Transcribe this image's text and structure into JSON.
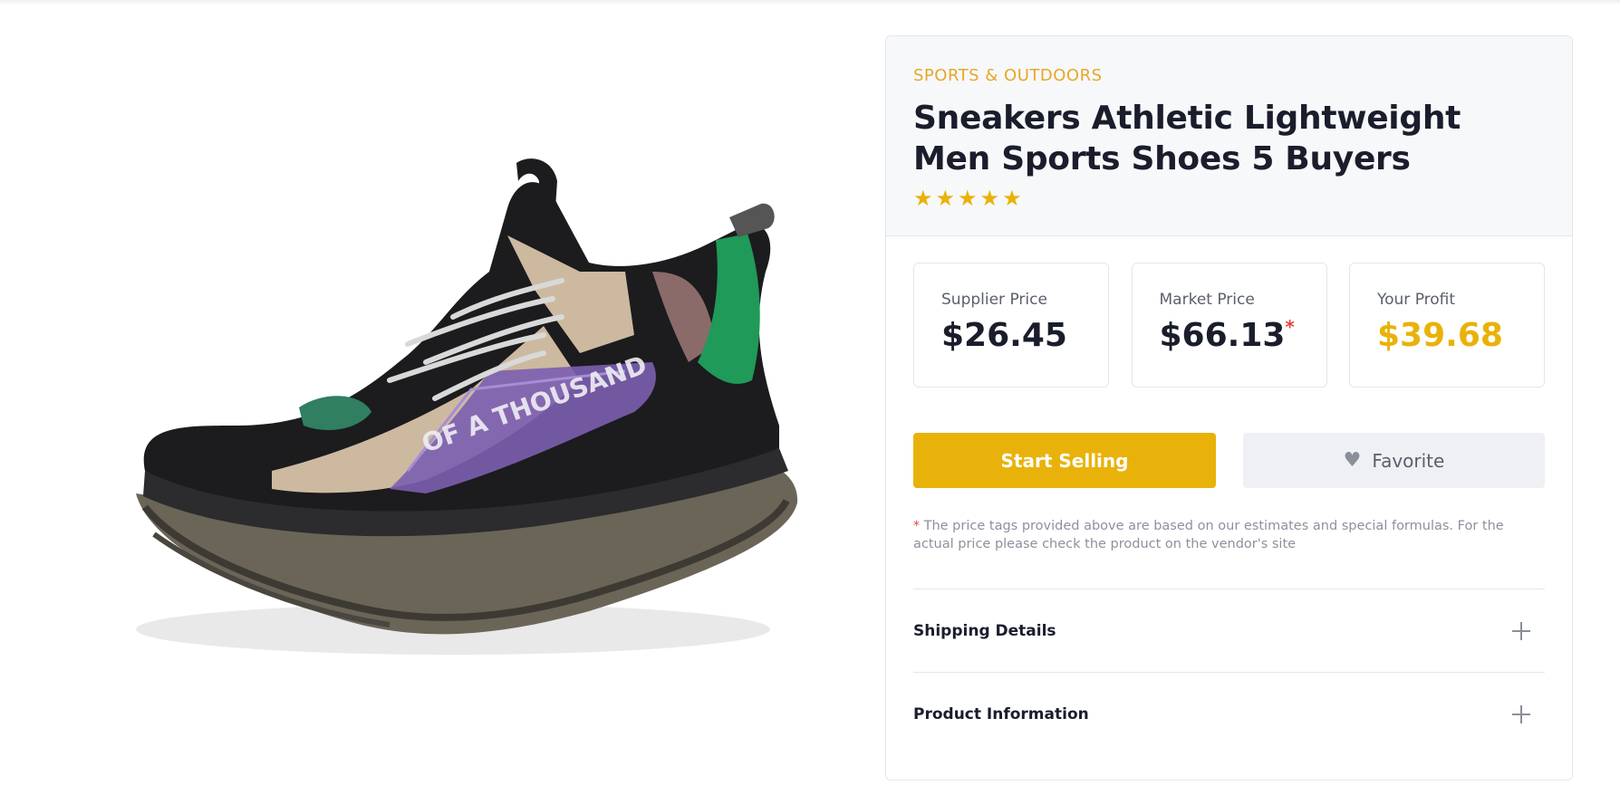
{
  "product": {
    "category": "SPORTS & OUTDOORS",
    "title": "Sneakers Athletic Lightweight Men Sports Shoes 5 Buyers",
    "rating": 5,
    "image_icon": "sneaker-image"
  },
  "prices": [
    {
      "label": "Supplier Price",
      "value": "$26.45"
    },
    {
      "label": "Market Price",
      "value": "$66.13",
      "marker": "*"
    },
    {
      "label": "Your Profit",
      "value": "$39.68"
    }
  ],
  "actions": {
    "start_selling": "Start Selling",
    "favorite": "Favorite",
    "favorite_icon": "heart-icon"
  },
  "disclaimer": {
    "marker": "*",
    "text": "The price tags provided above are based on our estimates and special formulas. For the actual price please check the product on the vendor's site"
  },
  "accordion": [
    {
      "label": "Shipping Details",
      "icon": "plus-icon"
    },
    {
      "label": "Product Information",
      "icon": "plus-icon"
    }
  ],
  "colors": {
    "accent": "#e9b20a",
    "category": "#e9a628",
    "asterisk": "#e6453c"
  }
}
